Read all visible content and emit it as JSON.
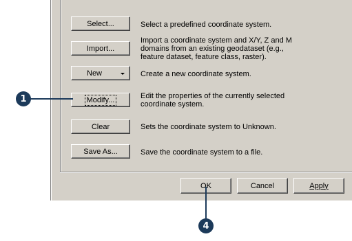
{
  "buttons": {
    "select": "Select...",
    "import": "Import...",
    "new": "New",
    "modify": "Modify...",
    "clear": "Clear",
    "save_as": "Save As..."
  },
  "descriptions": {
    "select": [
      "Select a predefined coordinate system."
    ],
    "import": [
      "Import a coordinate system and X/Y, Z and M",
      "domains from an existing geodataset (e.g.,",
      "feature dataset, feature class, raster)."
    ],
    "new": [
      "Create a new coordinate system."
    ],
    "modify": [
      "Edit the properties of the currently selected",
      "coordinate system."
    ],
    "clear": [
      "Sets the coordinate system to Unknown."
    ],
    "save_as": [
      "Save the coordinate system to a file."
    ]
  },
  "footer": {
    "ok": "OK",
    "cancel": "Cancel",
    "apply": "Apply"
  },
  "callouts": {
    "step1": "1",
    "step4": "4"
  },
  "colors": {
    "dialog_face": "#d4d0c8",
    "callout": "#1c3a5a"
  }
}
